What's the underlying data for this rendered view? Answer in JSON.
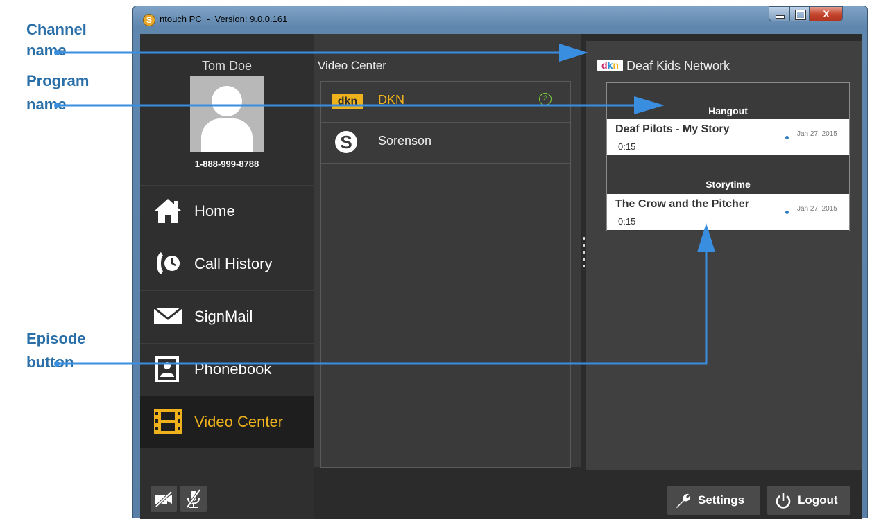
{
  "window": {
    "title_app": "ntouch PC",
    "title_sep": "-",
    "title_version": "Version: 9.0.0.161",
    "close_glyph": "X"
  },
  "user": {
    "name": "Tom Doe",
    "number": "1-888-999-8788"
  },
  "nav": [
    {
      "label": "Home",
      "icon": "home-icon"
    },
    {
      "label": "Call History",
      "icon": "call-history-icon"
    },
    {
      "label": "SignMail",
      "icon": "envelope-icon"
    },
    {
      "label": "Phonebook",
      "icon": "phonebook-icon"
    },
    {
      "label": "Video Center",
      "icon": "film-icon",
      "active": true
    }
  ],
  "video_center": {
    "title": "Video Center",
    "channels": [
      {
        "name": "DKN",
        "logo": "dkn",
        "badge": "2",
        "selected": true
      },
      {
        "name": "Sorenson",
        "logo": "S"
      }
    ]
  },
  "channel_panel": {
    "logo": {
      "d": "d",
      "k": "k",
      "n": "n"
    },
    "title": "Deaf Kids Network",
    "programs": [
      {
        "name": "Hangout",
        "episodes": [
          {
            "title": "Deaf Pilots - My Story",
            "duration": "0:15",
            "date": "Jan 27, 2015"
          }
        ]
      },
      {
        "name": "Storytime",
        "episodes": [
          {
            "title": "The Crow and the Pitcher",
            "duration": "0:15",
            "date": "Jan 27, 2015"
          }
        ]
      }
    ]
  },
  "bottom": {
    "settings_label": "Settings",
    "logout_label": "Logout"
  },
  "callouts": {
    "channel_1": "Channel",
    "channel_2": "name",
    "program_1": "Program",
    "program_2": "name",
    "episode_1": "Episode",
    "episode_2": "button"
  },
  "colors": {
    "accent": "#f0b21c",
    "callout": "#2a6fa8",
    "arrow": "#3a8ee0",
    "badge": "#7ad33b"
  }
}
